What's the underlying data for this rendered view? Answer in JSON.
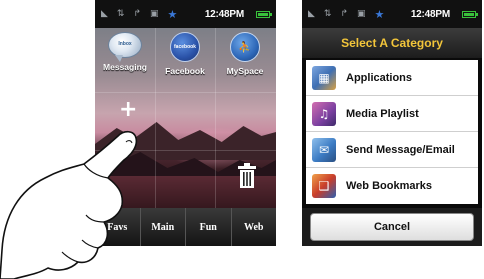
{
  "status_bar": {
    "time": "12:48PM"
  },
  "home_screen": {
    "apps": [
      {
        "label": "Messaging",
        "icon": "messaging-bubble-icon",
        "badge": "Inbox"
      },
      {
        "label": "Facebook",
        "icon": "facebook-icon",
        "badge": "facebook"
      },
      {
        "label": "MySpace",
        "icon": "myspace-icon"
      }
    ],
    "tabs": [
      "Favs",
      "Main",
      "Fun",
      "Web"
    ]
  },
  "category_dialog": {
    "title": "Select A Category",
    "items": [
      {
        "label": "Applications",
        "icon": "applications-icon"
      },
      {
        "label": "Media Playlist",
        "icon": "media-playlist-icon"
      },
      {
        "label": "Send Message/Email",
        "icon": "send-message-icon"
      },
      {
        "label": "Web Bookmarks",
        "icon": "web-bookmarks-icon"
      }
    ],
    "cancel_label": "Cancel",
    "title_color": "#f2c53a"
  }
}
